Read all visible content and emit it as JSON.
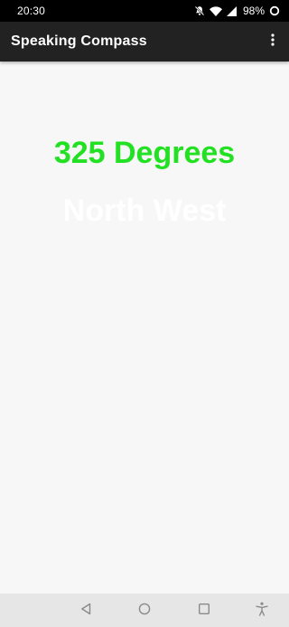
{
  "status_bar": {
    "time": "20:30",
    "battery_text": "98%",
    "icons": [
      "notifications-off-icon",
      "wifi-icon",
      "cell-signal-icon",
      "battery-ring-icon"
    ]
  },
  "app_bar": {
    "title": "Speaking Compass",
    "menu_icon": "more-vert-icon"
  },
  "compass": {
    "degrees_text": "325 Degrees",
    "direction_text": "North West"
  },
  "nav_bar": {
    "buttons": [
      "back-icon",
      "home-icon",
      "recents-icon",
      "accessibility-icon"
    ]
  },
  "colors": {
    "status_bar": "#000000",
    "app_bar": "#222222",
    "background": "#f7f7f7",
    "degrees_text": "#22e022",
    "direction_text": "#ffffff",
    "nav_bar": "#e6e6e6"
  }
}
